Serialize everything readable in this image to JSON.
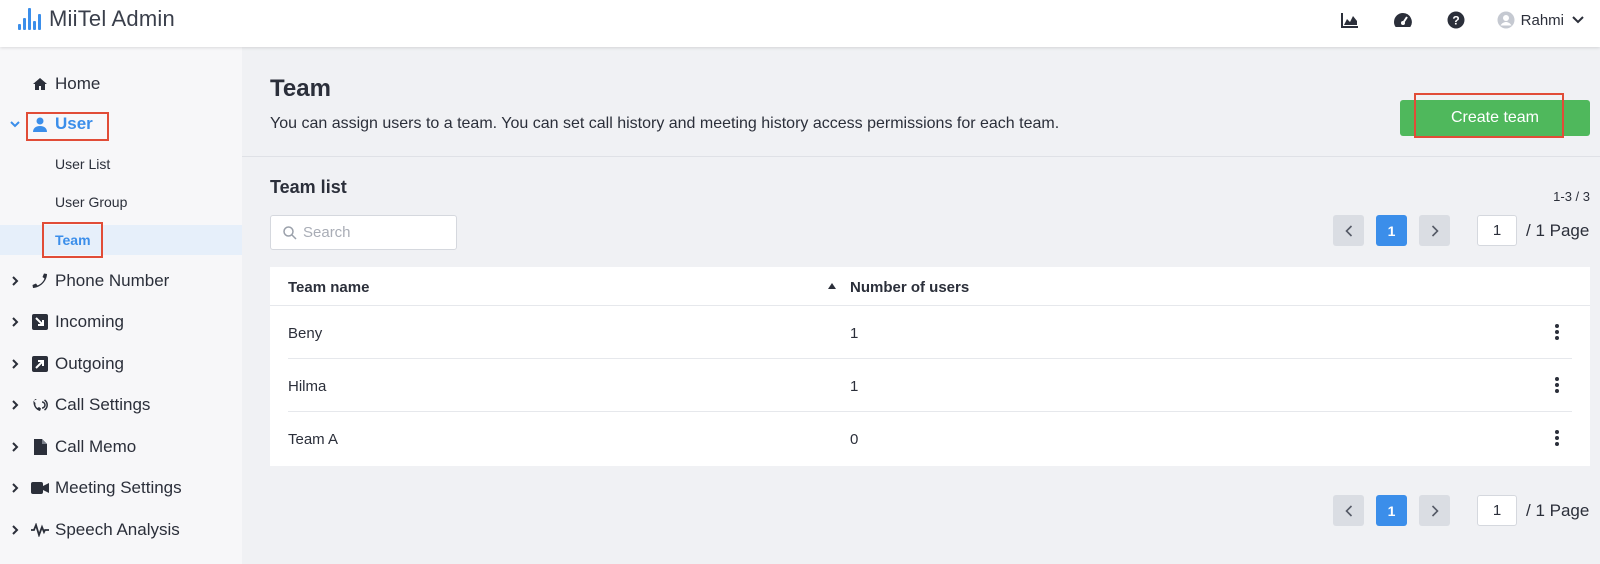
{
  "app": {
    "brand": "MiiTel",
    "suffix": "Admin"
  },
  "header": {
    "icons": [
      "analytics-icon",
      "dashboard-icon",
      "help-icon"
    ],
    "user_name": "Rahmi"
  },
  "sidebar": {
    "items": [
      {
        "label": "Home",
        "icon": "home-icon"
      },
      {
        "label": "User",
        "icon": "user-icon"
      },
      {
        "label": "Phone Number",
        "icon": "phone-icon"
      },
      {
        "label": "Incoming",
        "icon": "incoming-icon"
      },
      {
        "label": "Outgoing",
        "icon": "outgoing-icon"
      },
      {
        "label": "Call Settings",
        "icon": "call-settings-icon"
      },
      {
        "label": "Call Memo",
        "icon": "memo-icon"
      },
      {
        "label": "Meeting Settings",
        "icon": "video-icon"
      },
      {
        "label": "Speech Analysis",
        "icon": "waveform-icon"
      }
    ],
    "user_sub": [
      {
        "label": "User List"
      },
      {
        "label": "User Group"
      },
      {
        "label": "Team"
      }
    ]
  },
  "main": {
    "title": "Team",
    "description": "You can assign users to a team. You can set call history and meeting history access permissions for each team.",
    "create_button": "Create team",
    "list_title": "Team list",
    "count": "1-3 / 3",
    "search_placeholder": "Search",
    "pager": {
      "current": "1",
      "page_input": "1",
      "total": "/ 1 Page"
    },
    "table": {
      "headers": [
        "Team name",
        "Number of users"
      ],
      "rows": [
        {
          "name": "Beny",
          "users": "1"
        },
        {
          "name": "Hilma",
          "users": "1"
        },
        {
          "name": "Team A",
          "users": "0"
        }
      ]
    }
  },
  "colors": {
    "accent": "#3b8eea",
    "create": "#4fb85c",
    "highlight": "#e14c37"
  }
}
